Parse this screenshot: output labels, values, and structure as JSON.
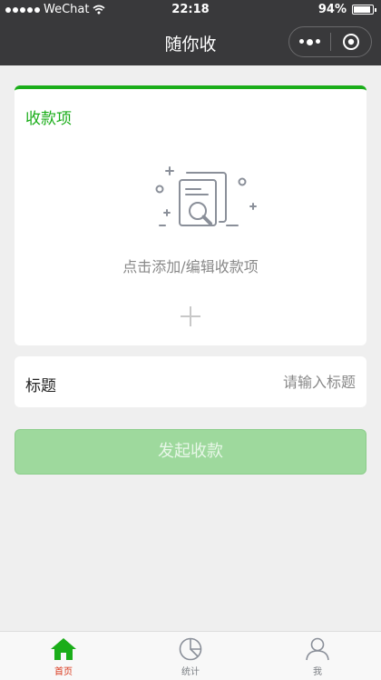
{
  "statusbar": {
    "carrier": "WeChat",
    "time": "22:18",
    "battery": "94%"
  },
  "navbar": {
    "title": "随你收",
    "more_icon": "more-dots-icon",
    "close_icon": "target-circle-icon"
  },
  "card": {
    "title": "收款项",
    "hint": "点击添加/编辑收款项",
    "illustration_icon": "document-search-icon",
    "add_icon": "plus-icon"
  },
  "title_field": {
    "label": "标题",
    "placeholder": "请输入标题",
    "value": ""
  },
  "submit": {
    "label": "发起收款"
  },
  "tabbar": {
    "tabs": [
      {
        "label": "首页",
        "icon": "home-icon",
        "active": true
      },
      {
        "label": "统计",
        "icon": "pie-chart-icon",
        "active": false
      },
      {
        "label": "我",
        "icon": "user-icon",
        "active": false
      }
    ]
  },
  "colors": {
    "brand_green": "#1aad19",
    "button_disabled": "#9ed99d",
    "tab_active": "#d9371b",
    "navbar": "#39393b"
  }
}
